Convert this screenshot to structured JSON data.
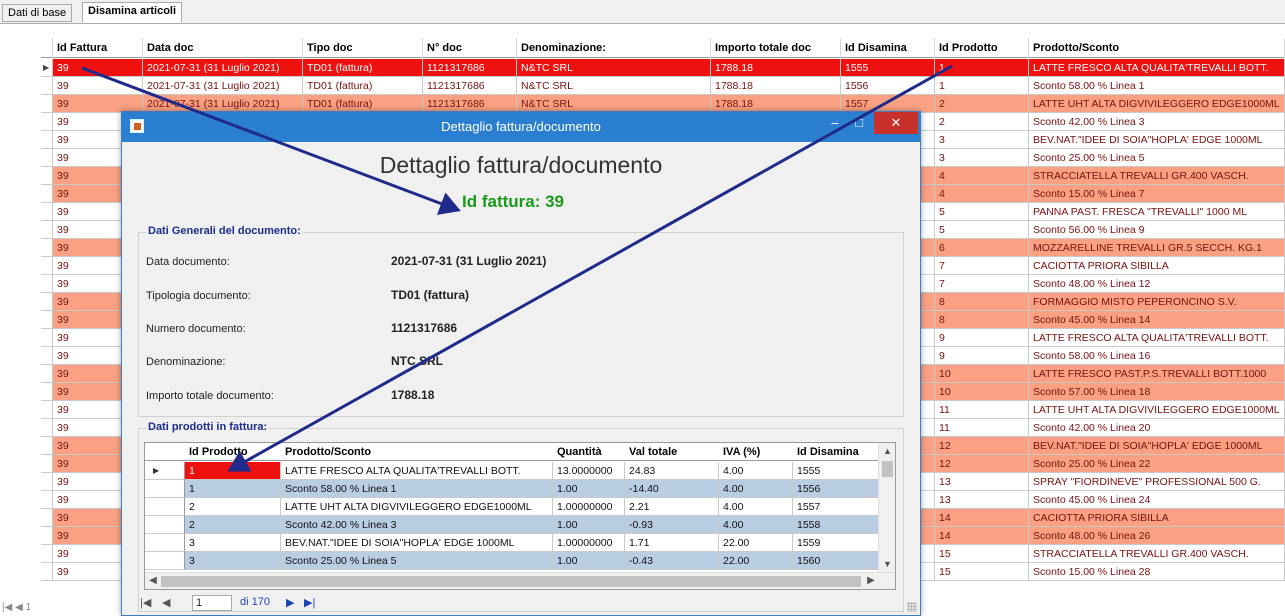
{
  "tabs": [
    {
      "label": "Dati di base",
      "active": false
    },
    {
      "label": "Disamina articoli",
      "active": true
    }
  ],
  "main_grid": {
    "headers": {
      "id_fattura": "Id Fattura",
      "data_doc": "Data doc",
      "tipo_doc": "Tipo doc",
      "n_doc": "N° doc",
      "denominazione": "Denominazione:",
      "importo": "Importo totale doc",
      "id_disamina": "Id Disamina",
      "id_prodotto": "Id Prodotto",
      "prodotto": "Prodotto/Sconto"
    },
    "rows": [
      {
        "style": "red",
        "id_fattura": "39",
        "data_doc": "2021-07-31 (31 Luglio 2021)",
        "tipo_doc": "TD01 (fattura)",
        "n_doc": "1121317686",
        "denominazione": "N&TC SRL",
        "importo": "1788.18",
        "id_disamina": "1555",
        "id_prodotto": "1",
        "prodotto": "LATTE FRESCO ALTA QUALITA'TREVALLI BOTT."
      },
      {
        "style": "white",
        "id_fattura": "39",
        "data_doc": "2021-07-31 (31 Luglio 2021)",
        "tipo_doc": "TD01 (fattura)",
        "n_doc": "1121317686",
        "denominazione": "N&TC SRL",
        "importo": "1788.18",
        "id_disamina": "1556",
        "id_prodotto": "1",
        "prodotto": "Sconto 58.00 % Linea 1"
      },
      {
        "style": "orange",
        "id_fattura": "39",
        "data_doc": "2021-07-31 (31 Luglio 2021)",
        "tipo_doc": "TD01 (fattura)",
        "n_doc": "1121317686",
        "denominazione": "N&TC SRL",
        "importo": "1788.18",
        "id_disamina": "1557",
        "id_prodotto": "2",
        "prodotto": "LATTE UHT ALTA DIGVIVILEGGERO EDGE1000ML"
      },
      {
        "style": "white",
        "id_fattura": "39",
        "id_prodotto": "2",
        "prodotto": "Sconto 42.00 % Linea 3"
      },
      {
        "style": "white",
        "id_fattura": "39",
        "id_prodotto": "3",
        "prodotto": "BEV.NAT.\"IDEE DI SOIA\"HOPLA' EDGE 1000ML"
      },
      {
        "style": "white",
        "id_fattura": "39",
        "id_prodotto": "3",
        "prodotto": "Sconto 25.00 % Linea 5"
      },
      {
        "style": "orange",
        "id_fattura": "39",
        "id_prodotto": "4",
        "prodotto": "STRACCIATELLA TREVALLI GR.400 VASCH."
      },
      {
        "style": "orange",
        "id_fattura": "39",
        "id_prodotto": "4",
        "prodotto": "Sconto 15.00 % Linea 7"
      },
      {
        "style": "white",
        "id_fattura": "39",
        "id_prodotto": "5",
        "prodotto": "PANNA PAST. FRESCA \"TREVALLI\" 1000 ML"
      },
      {
        "style": "white",
        "id_fattura": "39",
        "id_prodotto": "5",
        "prodotto": "Sconto 56.00 % Linea 9"
      },
      {
        "style": "orange",
        "id_fattura": "39",
        "id_prodotto": "6",
        "prodotto": "MOZZARELLINE TREVALLI GR.5 SECCH. KG.1"
      },
      {
        "style": "white",
        "id_fattura": "39",
        "id_prodotto": "7",
        "prodotto": "CACIOTTA PRIORA SIBILLA"
      },
      {
        "style": "white",
        "id_fattura": "39",
        "id_prodotto": "7",
        "prodotto": "Sconto 48.00 % Linea 12"
      },
      {
        "style": "orange",
        "id_fattura": "39",
        "id_prodotto": "8",
        "prodotto": "FORMAGGIO MISTO PEPERONCINO S.V."
      },
      {
        "style": "orange",
        "id_fattura": "39",
        "id_prodotto": "8",
        "prodotto": "Sconto 45.00 % Linea 14"
      },
      {
        "style": "white",
        "id_fattura": "39",
        "id_prodotto": "9",
        "prodotto": "LATTE FRESCO ALTA QUALITA'TREVALLI BOTT."
      },
      {
        "style": "white",
        "id_fattura": "39",
        "id_prodotto": "9",
        "prodotto": "Sconto 58.00 % Linea 16"
      },
      {
        "style": "orange",
        "id_fattura": "39",
        "id_prodotto": "10",
        "prodotto": "LATTE FRESCO PAST.P.S.TREVALLI BOTT.1000"
      },
      {
        "style": "orange",
        "id_fattura": "39",
        "id_prodotto": "10",
        "prodotto": "Sconto 57.00 % Linea 18"
      },
      {
        "style": "white",
        "id_fattura": "39",
        "id_prodotto": "11",
        "prodotto": "LATTE UHT ALTA DIGVIVILEGGERO EDGE1000ML"
      },
      {
        "style": "white",
        "id_fattura": "39",
        "id_prodotto": "11",
        "prodotto": "Sconto 42.00 % Linea 20"
      },
      {
        "style": "orange",
        "id_fattura": "39",
        "id_prodotto": "12",
        "prodotto": "BEV.NAT.\"IDEE DI SOIA\"HOPLA' EDGE 1000ML"
      },
      {
        "style": "orange",
        "id_fattura": "39",
        "id_prodotto": "12",
        "prodotto": "Sconto 25.00 % Linea 22"
      },
      {
        "style": "white",
        "id_fattura": "39",
        "id_prodotto": "13",
        "prodotto": "SPRAY \"FIORDINEVE\" PROFESSIONAL 500 G."
      },
      {
        "style": "white",
        "id_fattura": "39",
        "id_prodotto": "13",
        "prodotto": "Sconto 45.00 % Linea 24"
      },
      {
        "style": "orange",
        "id_fattura": "39",
        "id_prodotto": "14",
        "prodotto": "CACIOTTA PRIORA SIBILLA"
      },
      {
        "style": "orange",
        "id_fattura": "39",
        "id_prodotto": "14",
        "prodotto": "Sconto 48.00 % Linea 26"
      },
      {
        "style": "white",
        "id_fattura": "39",
        "id_prodotto": "15",
        "prodotto": "STRACCIATELLA TREVALLI GR.400 VASCH."
      },
      {
        "style": "white",
        "id_fattura": "39",
        "id_prodotto": "15",
        "prodotto": "Sconto 15.00 % Linea 28"
      }
    ],
    "nav_text": "1"
  },
  "dialog": {
    "title": "Dettaglio fattura/documento",
    "heading": "Dettaglio fattura/documento",
    "subheading": "Id fattura: 39",
    "general_group_label": "Dati Generali del documento:",
    "fields": [
      {
        "label": "Data documento:",
        "value": "2021-07-31 (31 Luglio 2021)"
      },
      {
        "label": "Tipologia documento:",
        "value": "TD01 (fattura)"
      },
      {
        "label": "Numero documento:",
        "value": "1121317686"
      },
      {
        "label": "Denominazione:",
        "value": "NTC SRL"
      },
      {
        "label": "Importo totale documento:",
        "value": "1788.18"
      }
    ],
    "products_group_label": "Dati prodotti in fattura:",
    "products_headers": {
      "id_prodotto": "Id Prodotto",
      "prodotto": "Prodotto/Sconto",
      "quantita": "Quantità",
      "val_totale": "Val totale",
      "iva": "IVA (%)",
      "id_disamina": "Id Disamina"
    },
    "products": [
      {
        "style": "white",
        "selected": true,
        "id_prodotto": "1",
        "prodotto": "LATTE FRESCO ALTA QUALITA'TREVALLI BOTT.",
        "quantita": "13.0000000",
        "val_totale": "24.83",
        "iva": "4.00",
        "id_disamina": "1555"
      },
      {
        "style": "blue",
        "selected": false,
        "id_prodotto": "1",
        "prodotto": "Sconto 58.00 % Linea 1",
        "quantita": "1.00",
        "val_totale": "-14.40",
        "iva": "4.00",
        "id_disamina": "1556"
      },
      {
        "style": "white",
        "selected": false,
        "id_prodotto": "2",
        "prodotto": "LATTE UHT ALTA DIGVIVILEGGERO EDGE1000ML",
        "quantita": "1.00000000",
        "val_totale": "2.21",
        "iva": "4.00",
        "id_disamina": "1557"
      },
      {
        "style": "blue",
        "selected": false,
        "id_prodotto": "2",
        "prodotto": "Sconto 42.00 % Linea 3",
        "quantita": "1.00",
        "val_totale": "-0.93",
        "iva": "4.00",
        "id_disamina": "1558"
      },
      {
        "style": "white",
        "selected": false,
        "id_prodotto": "3",
        "prodotto": "BEV.NAT.\"IDEE DI SOIA\"HOPLA' EDGE 1000ML",
        "quantita": "1.00000000",
        "val_totale": "1.71",
        "iva": "22.00",
        "id_disamina": "1559"
      },
      {
        "style": "blue",
        "selected": false,
        "id_prodotto": "3",
        "prodotto": "Sconto 25.00 % Linea 5",
        "quantita": "1.00",
        "val_totale": "-0.43",
        "iva": "22.00",
        "id_disamina": "1560"
      }
    ],
    "nav": {
      "page": "1",
      "of_label": "di 170"
    }
  },
  "colors": {
    "selected_red": "#ef1010",
    "row_orange": "#f9a182",
    "row_blue": "#b9cde3",
    "titlebar_blue": "#2b7fd0",
    "heading_green": "#1a9a1a",
    "group_label_blue": "#1b2c8c",
    "annotation_arrow": "#1f2a8a"
  },
  "icons": {
    "row_pointer": "triangle-right-icon",
    "app": "app-document-icon"
  }
}
